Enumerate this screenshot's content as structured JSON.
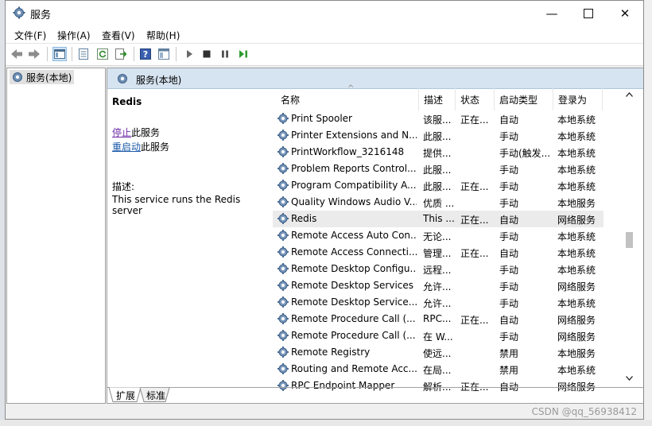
{
  "window": {
    "title": "服务"
  },
  "menu": [
    "文件(F)",
    "操作(A)",
    "查看(V)",
    "帮助(H)"
  ],
  "tree": {
    "item": "服务(本地)"
  },
  "pane": {
    "header": "服务(本地)"
  },
  "details": {
    "service_name": "Redis",
    "stop_link": "停止",
    "stop_suffix": "此服务",
    "restart_link": "重启动",
    "restart_suffix": "此服务",
    "desc_label": "描述:",
    "desc_text": "This service runs the Redis server"
  },
  "columns": [
    "名称",
    "描述",
    "状态",
    "启动类型",
    "登录为"
  ],
  "services": [
    {
      "name": "Print Spooler",
      "desc": "该服...",
      "status": "正在...",
      "startup": "自动",
      "logon": "本地系统"
    },
    {
      "name": "Printer Extensions and N...",
      "desc": "此服...",
      "status": "",
      "startup": "手动",
      "logon": "本地系统"
    },
    {
      "name": "PrintWorkflow_3216148",
      "desc": "提供...",
      "status": "",
      "startup": "手动(触发...",
      "logon": "本地系统"
    },
    {
      "name": "Problem Reports Control...",
      "desc": "此服...",
      "status": "",
      "startup": "手动",
      "logon": "本地系统"
    },
    {
      "name": "Program Compatibility A...",
      "desc": "此服...",
      "status": "正在...",
      "startup": "手动",
      "logon": "本地系统"
    },
    {
      "name": "Quality Windows Audio V...",
      "desc": "优质 ...",
      "status": "",
      "startup": "手动",
      "logon": "本地服务"
    },
    {
      "name": "Redis",
      "desc": "This ...",
      "status": "正在...",
      "startup": "自动",
      "logon": "网络服务"
    },
    {
      "name": "Remote Access Auto Con...",
      "desc": "无论...",
      "status": "",
      "startup": "手动",
      "logon": "本地系统"
    },
    {
      "name": "Remote Access Connecti...",
      "desc": "管理...",
      "status": "正在...",
      "startup": "自动",
      "logon": "本地系统"
    },
    {
      "name": "Remote Desktop Configu...",
      "desc": "远程...",
      "status": "",
      "startup": "手动",
      "logon": "本地系统"
    },
    {
      "name": "Remote Desktop Services",
      "desc": "允许...",
      "status": "",
      "startup": "手动",
      "logon": "网络服务"
    },
    {
      "name": "Remote Desktop Service...",
      "desc": "允许...",
      "status": "",
      "startup": "手动",
      "logon": "本地系统"
    },
    {
      "name": "Remote Procedure Call (...",
      "desc": "RPC...",
      "status": "正在...",
      "startup": "自动",
      "logon": "网络服务"
    },
    {
      "name": "Remote Procedure Call (...",
      "desc": "在 W...",
      "status": "",
      "startup": "手动",
      "logon": "网络服务"
    },
    {
      "name": "Remote Registry",
      "desc": "使远...",
      "status": "",
      "startup": "禁用",
      "logon": "本地服务"
    },
    {
      "name": "Routing and Remote Acc...",
      "desc": "在局...",
      "status": "",
      "startup": "禁用",
      "logon": "本地系统"
    },
    {
      "name": "RPC Endpoint Mapper",
      "desc": "解析...",
      "status": "正在...",
      "startup": "自动",
      "logon": "网络服务"
    }
  ],
  "tabs": [
    "扩展",
    "标准"
  ],
  "watermark": "CSDN @qq_56938412"
}
